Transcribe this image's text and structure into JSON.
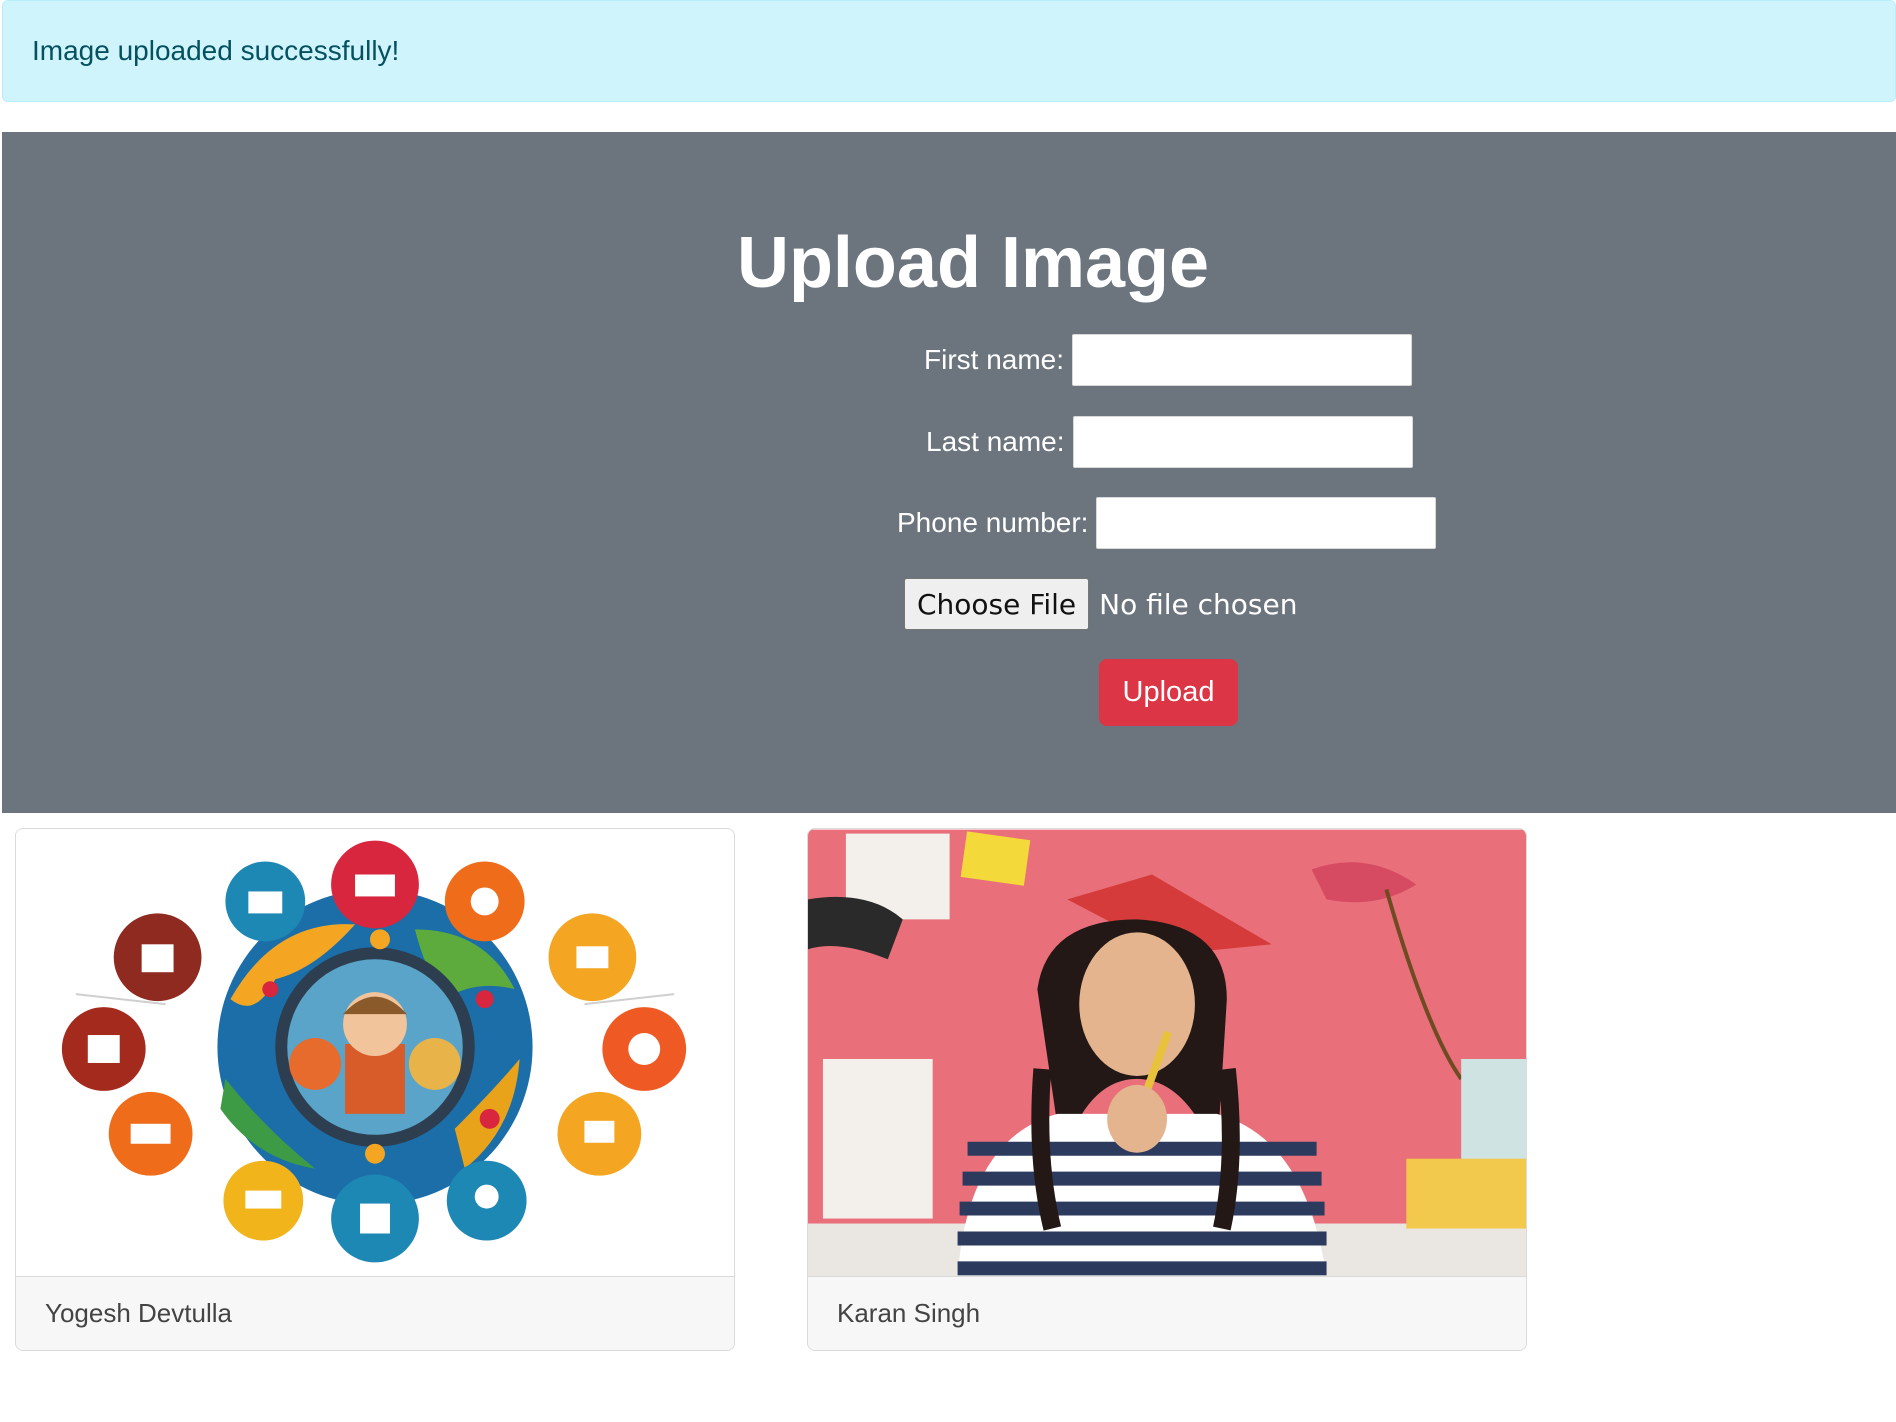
{
  "alert": {
    "message": "Image uploaded successfully!"
  },
  "form": {
    "title": "Upload Image",
    "first_name_label": "First name:",
    "first_name_value": "",
    "last_name_label": "Last name:",
    "last_name_value": "",
    "phone_label": "Phone number:",
    "phone_value": "",
    "file_button_label": "Choose File",
    "file_status": "No file chosen",
    "submit_label": "Upload"
  },
  "gallery": [
    {
      "name": "Yogesh Devtulla",
      "image": "education-globe-illustration"
    },
    {
      "name": "Karan Singh",
      "image": "thoughtful-student-with-book-photo"
    }
  ],
  "colors": {
    "alert_bg": "#cff4fc",
    "alert_text": "#055160",
    "hero_bg": "#6c757d",
    "submit_bg": "#dc3545"
  }
}
